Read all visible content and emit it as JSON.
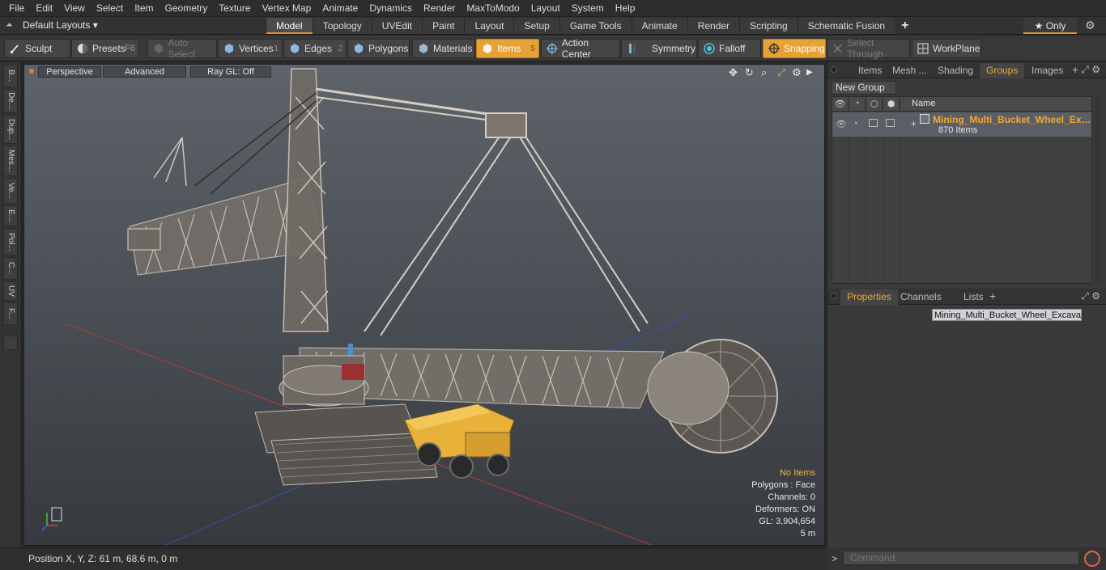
{
  "menu": [
    "File",
    "Edit",
    "View",
    "Select",
    "Item",
    "Geometry",
    "Texture",
    "Vertex Map",
    "Animate",
    "Dynamics",
    "Render",
    "MaxToModo",
    "Layout",
    "System",
    "Help"
  ],
  "layout": {
    "label": "Default Layouts ▾"
  },
  "tabs": [
    "Model",
    "Topology",
    "UVEdit",
    "Paint",
    "Layout",
    "Setup",
    "Game Tools",
    "Animate",
    "Render",
    "Scripting",
    "Schematic Fusion"
  ],
  "only_label": "★  Only",
  "toolbar": {
    "sculpt": "Sculpt",
    "presets": "Presets",
    "presets_key": "F6",
    "auto_select": "Auto Select",
    "vertices": "Vertices",
    "vertices_num": "1",
    "edges": "Edges",
    "edges_num": "2",
    "polygons": "Polygons",
    "materials": "Materials",
    "items": "Items",
    "items_num": "5",
    "action_center": "Action Center",
    "symmetry": "Symmetry",
    "falloff": "Falloff",
    "snapping": "Snapping",
    "select_through": "Select Through",
    "workplane": "WorkPlane"
  },
  "left_tabs": [
    "B...",
    "De...",
    "Dup...",
    "Mes...",
    "Ve...",
    "E...",
    "Pol...",
    "C...",
    "UV",
    "F..."
  ],
  "viewport": {
    "perspective": "Perspective",
    "advanced": "Advanced",
    "raygl": "Ray GL: Off",
    "info": {
      "items": "No Items",
      "polygons": "Polygons : Face",
      "channels": "Channels: 0",
      "deformers": "Deformers: ON",
      "gl": "GL: 3,904,654",
      "scale": "5 m"
    }
  },
  "status": {
    "position": "Position X, Y, Z:   61 m, 68.6 m, 0 m"
  },
  "groups_panel": {
    "tabs": [
      "Items",
      "Mesh ...",
      "Shading",
      "Groups",
      "Images"
    ],
    "active_tab": "Groups",
    "new_group": "New Group",
    "col_name": "Name",
    "group": {
      "name": "Mining_Multi_Bucket_Wheel_Ex ...",
      "count": "870 Items"
    }
  },
  "properties_panel": {
    "tabs": [
      "Properties",
      "Channels",
      "Lists"
    ],
    "active_tab": "Properties",
    "name_value": "Mining_Multi_Bucket_Wheel_Excavato"
  },
  "command": {
    "placeholder": "Command"
  },
  "colors": {
    "accent": "#e6a234",
    "active_tab_text": "#f0a838",
    "background": "#2b2b2b"
  }
}
